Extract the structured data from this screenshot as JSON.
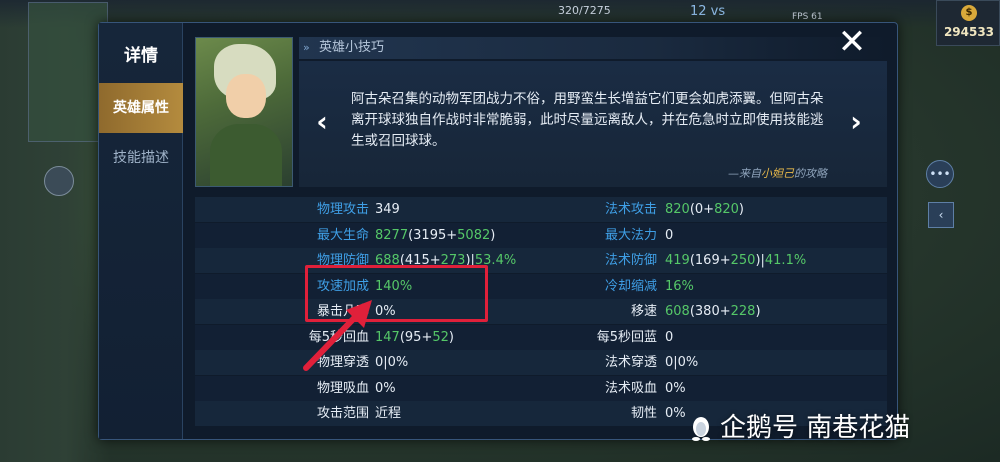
{
  "hud": {
    "score": "320/7275",
    "kills": "12 vs",
    "fps": "FPS 61",
    "gold": "294533"
  },
  "sidebar": {
    "title": "详情",
    "tabs": [
      {
        "label": "英雄属性",
        "active": true
      },
      {
        "label": "技能描述",
        "active": false
      }
    ]
  },
  "tips": {
    "header": "英雄小技巧",
    "text": "阿古朵召集的动物军团战力不俗，用野蛮生长增益它们更会如虎添翼。但阿古朵离开球球独自作战时非常脆弱，此时尽量远离敌人，并在危急时立即使用技能逃生或召回球球。",
    "source_prefix": "—来自",
    "source_author": "小妲己",
    "source_suffix": "的攻略",
    "prev_label": "‹",
    "next_label": "›"
  },
  "stats": {
    "left": [
      {
        "label": "物理攻击",
        "label_color": "blue",
        "value": "349",
        "parts": []
      },
      {
        "label": "最大生命",
        "label_color": "blue",
        "value": "",
        "parts": [
          {
            "t": "8277",
            "c": "green"
          },
          {
            "t": "(3195+",
            "c": "white"
          },
          {
            "t": "5082",
            "c": "green"
          },
          {
            "t": ")",
            "c": "white"
          }
        ]
      },
      {
        "label": "物理防御",
        "label_color": "blue",
        "value": "",
        "parts": [
          {
            "t": "688",
            "c": "green"
          },
          {
            "t": "(415+",
            "c": "white"
          },
          {
            "t": "273",
            "c": "green"
          },
          {
            "t": ")|",
            "c": "white"
          },
          {
            "t": "53.4%",
            "c": "green"
          }
        ]
      },
      {
        "label": "攻速加成",
        "label_color": "blue",
        "value": "",
        "parts": [
          {
            "t": "140%",
            "c": "green"
          }
        ]
      },
      {
        "label": "暴击几率",
        "label_color": "white",
        "value": "0%",
        "parts": []
      },
      {
        "label": "每5秒回血",
        "label_color": "white",
        "value": "",
        "parts": [
          {
            "t": "147",
            "c": "green"
          },
          {
            "t": "(95+",
            "c": "white"
          },
          {
            "t": "52",
            "c": "green"
          },
          {
            "t": ")",
            "c": "white"
          }
        ]
      },
      {
        "label": "物理穿透",
        "label_color": "white",
        "value": "0|0%",
        "parts": []
      },
      {
        "label": "物理吸血",
        "label_color": "white",
        "value": "0%",
        "parts": []
      },
      {
        "label": "攻击范围",
        "label_color": "white",
        "value": "近程",
        "parts": []
      }
    ],
    "right": [
      {
        "label": "法术攻击",
        "label_color": "blue",
        "value": "",
        "parts": [
          {
            "t": "820",
            "c": "green"
          },
          {
            "t": "(0+",
            "c": "white"
          },
          {
            "t": "820",
            "c": "green"
          },
          {
            "t": ")",
            "c": "white"
          }
        ]
      },
      {
        "label": "最大法力",
        "label_color": "blue",
        "value": "0",
        "parts": []
      },
      {
        "label": "法术防御",
        "label_color": "blue",
        "value": "",
        "parts": [
          {
            "t": "419",
            "c": "green"
          },
          {
            "t": "(169+",
            "c": "white"
          },
          {
            "t": "250",
            "c": "green"
          },
          {
            "t": ")|",
            "c": "white"
          },
          {
            "t": "41.1%",
            "c": "green"
          }
        ]
      },
      {
        "label": "冷却缩减",
        "label_color": "blue",
        "value": "",
        "parts": [
          {
            "t": "16%",
            "c": "green"
          }
        ]
      },
      {
        "label": "移速",
        "label_color": "white",
        "value": "",
        "parts": [
          {
            "t": "608",
            "c": "green"
          },
          {
            "t": "(380+",
            "c": "white"
          },
          {
            "t": "228",
            "c": "green"
          },
          {
            "t": ")",
            "c": "white"
          }
        ]
      },
      {
        "label": "每5秒回蓝",
        "label_color": "white",
        "value": "0",
        "parts": []
      },
      {
        "label": "法术穿透",
        "label_color": "white",
        "value": "0|0%",
        "parts": []
      },
      {
        "label": "法术吸血",
        "label_color": "white",
        "value": "0%",
        "parts": []
      },
      {
        "label": "韧性",
        "label_color": "white",
        "value": "0%",
        "parts": []
      }
    ]
  },
  "close_label": "✕",
  "watermark": "企鹅号 南巷花猫",
  "colors": {
    "label_blue": "#3f9fe6",
    "value_green": "#55c768",
    "highlight_red": "#e0203a",
    "tab_active": "#b48b3e"
  }
}
